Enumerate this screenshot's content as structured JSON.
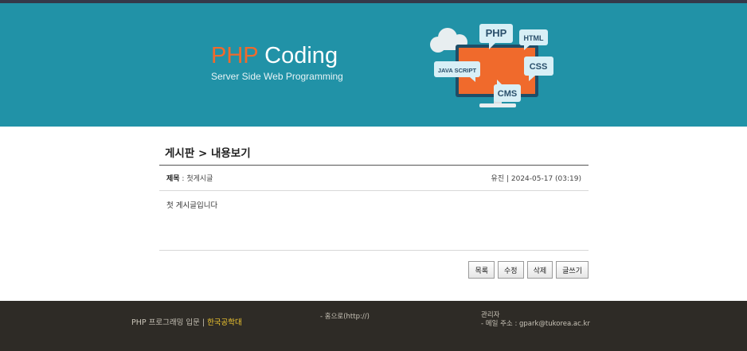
{
  "header": {
    "logo_php": "PHP",
    "logo_coding": " Coding",
    "logo_sub": "Server Side Web Programming",
    "illustration": {
      "bubbles": [
        "PHP",
        "HTML",
        "JAVA SCRIPT",
        "CSS",
        "CMS"
      ],
      "colors": {
        "monitor": "#f06a2c",
        "bubble": "#d8eff6",
        "text": "#2a4f6b",
        "cloud": "#e8eef0"
      }
    }
  },
  "board": {
    "title": "게시판 > 내용보기",
    "subject_label": "제목",
    "subject_sep": " : ",
    "subject_value": "첫게시글",
    "author_date": "유진 | 2024-05-17 (03:19)",
    "content": "첫 게시글입니다",
    "buttons": {
      "list": "목록",
      "edit": "수정",
      "delete": "삭제",
      "write": "글쓰기"
    }
  },
  "footer": {
    "course": "PHP 프로그래밍 입문 | ",
    "school": "한국공학대",
    "home": "- 홈으로(http://)",
    "admin_title": "관리자",
    "admin_email": "- 메일 주소 : gpark@tukorea.ac.kr"
  },
  "colors": {
    "header_bg": "#2192a7",
    "accent": "#f06a2c",
    "footer_bg": "#2e2b26",
    "footer_highlight": "#f2c830"
  }
}
